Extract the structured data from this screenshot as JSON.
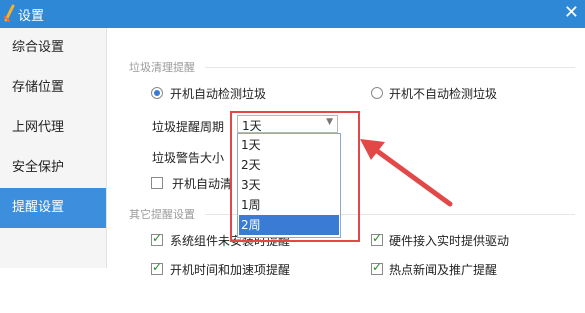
{
  "window": {
    "title": "设置",
    "close_glyph": "✕"
  },
  "sidebar": {
    "items": [
      {
        "label": "综合设置"
      },
      {
        "label": "存储位置"
      },
      {
        "label": "上网代理"
      },
      {
        "label": "安全保护"
      },
      {
        "label": "提醒设置",
        "active": true
      }
    ]
  },
  "main": {
    "garbage": {
      "section_title": "垃圾清理提醒",
      "auto_detect": {
        "label": "开机自动检测垃圾",
        "checked": true
      },
      "no_auto_detect": {
        "label": "开机不自动检测垃圾",
        "checked": false
      },
      "period_label": "垃圾提醒周期",
      "period_value": "1天",
      "size_label": "垃圾警告大小",
      "startup_label": "开机自动清",
      "period_options": [
        "1天",
        "2天",
        "3天",
        "1周",
        "2周"
      ],
      "highlighted_option": "2周"
    },
    "other": {
      "section_title": "其它提醒设置",
      "options": [
        {
          "label": "系统组件未安装时提醒",
          "checked": true
        },
        {
          "label": "硬件接入实时提供驱动",
          "checked": true
        },
        {
          "label": "开机时间和加速项提醒",
          "checked": true
        },
        {
          "label": "热点新闻及推广提醒",
          "checked": true
        }
      ]
    }
  },
  "colors": {
    "titlebar": "#2f88d6",
    "active_nav": "#3d8fde",
    "annotation": "#e24848"
  }
}
